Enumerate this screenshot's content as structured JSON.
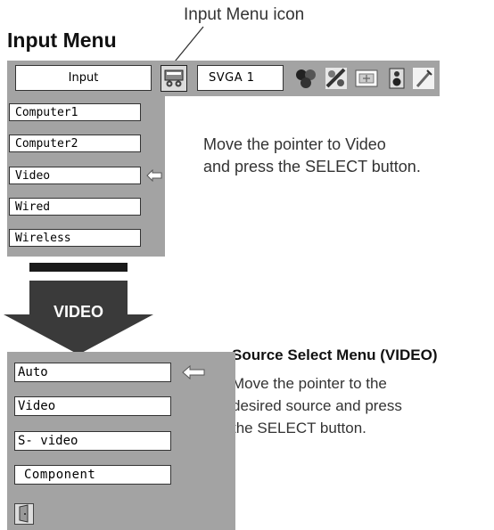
{
  "header": {
    "title": "Input Menu",
    "callout": "Input Menu icon"
  },
  "menubar": {
    "input_label": "Input",
    "resolution_value": "SVGA 1",
    "icons": [
      "input-menu-icon",
      "image-adjust-icon",
      "color-adjust-icon",
      "screen-icon",
      "sound-icon",
      "setting-icon"
    ]
  },
  "input_list": {
    "items": [
      {
        "label": "Computer1"
      },
      {
        "label": "Computer2"
      },
      {
        "label": "Video"
      },
      {
        "label": "Wired"
      },
      {
        "label": "Wireless"
      }
    ],
    "pointer_target": "Video"
  },
  "instruction1": {
    "line1": "Move the pointer to Video",
    "line2": "and press the SELECT button."
  },
  "arrow_label": "VIDEO",
  "source_menu": {
    "heading": "Source Select Menu (VIDEO)",
    "items": [
      {
        "label": "Auto"
      },
      {
        "label": "Video"
      },
      {
        "label": "S- video"
      },
      {
        "label": "Component"
      }
    ],
    "pointer_target": "Auto",
    "exit_icon": "exit-door-icon"
  },
  "instruction2": {
    "line1": "Move the pointer to the",
    "line2": "desired source and press",
    "line3": "the SELECT button."
  },
  "colors": {
    "menu_gray": "#a3a3a3",
    "arrow_dark": "#3a3a3a"
  }
}
